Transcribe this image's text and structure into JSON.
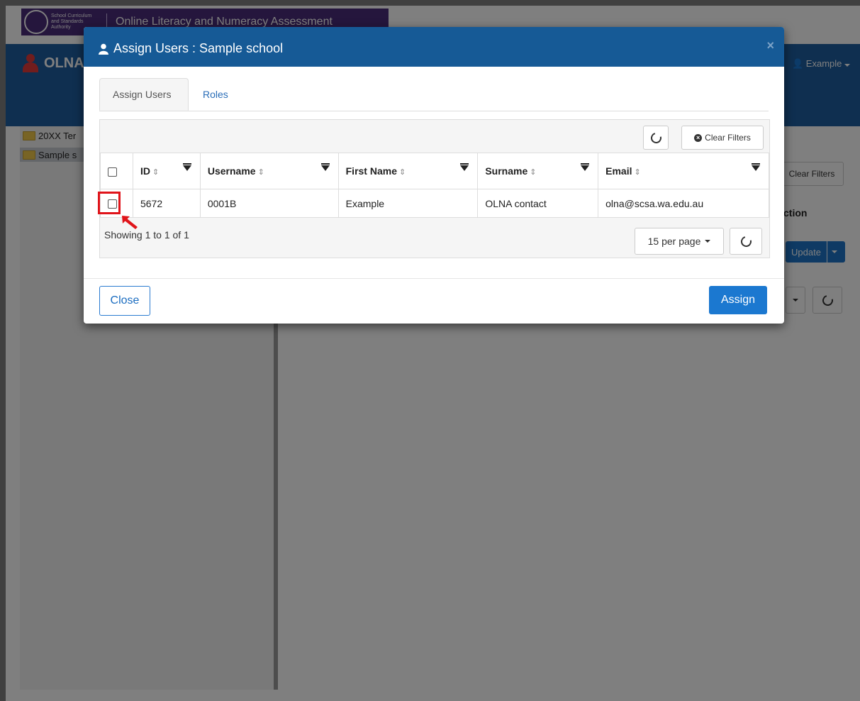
{
  "background": {
    "logo": {
      "org_text": "School Curriculum and Standards Authority",
      "app_title": "Online Literacy and Numeracy Assessment"
    },
    "navbar": {
      "brand": "OLNA",
      "user": "Example"
    },
    "tree": [
      {
        "label": "20XX Ter"
      },
      {
        "label": "Sample s"
      }
    ],
    "main": {
      "clear_filters": "Clear Filters",
      "action_header": "ction",
      "update_label": "Update"
    }
  },
  "modal": {
    "title": "Assign Users : Sample school",
    "close_glyph": "×",
    "tabs": [
      {
        "label": "Assign Users",
        "active": true
      },
      {
        "label": "Roles",
        "active": false
      }
    ],
    "toolbar": {
      "clear_filters": "Clear Filters"
    },
    "table": {
      "columns": [
        {
          "label": "ID"
        },
        {
          "label": "Username"
        },
        {
          "label": "First Name"
        },
        {
          "label": "Surname"
        },
        {
          "label": "Email"
        }
      ],
      "rows": [
        {
          "id": "5672",
          "username": "0001B",
          "first_name": "Example",
          "surname": "OLNA contact",
          "email": "olna@scsa.wa.edu.au"
        }
      ]
    },
    "pagination": {
      "showing": "Showing 1 to 1 of 1",
      "per_page": "15 per page"
    },
    "footer": {
      "close_label": "Close",
      "assign_label": "Assign"
    }
  },
  "colors": {
    "header_blue": "#165a96",
    "accent_blue": "#1b78d0",
    "highlight_red": "#e0141a"
  }
}
